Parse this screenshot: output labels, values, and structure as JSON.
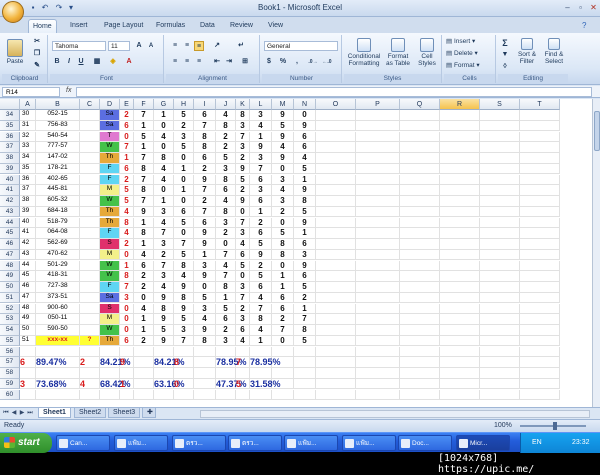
{
  "window": {
    "title": "Book1 - Microsoft Excel"
  },
  "ribbon_tabs": [
    "Home",
    "Insert",
    "Page Layout",
    "Formulas",
    "Data",
    "Review",
    "View"
  ],
  "ribbon": {
    "clipboard": {
      "paste": "Paste",
      "label": "Clipboard"
    },
    "font": {
      "name": "Tahoma",
      "size": "11",
      "bold": "B",
      "italic": "I",
      "underline": "U",
      "grow": "A",
      "shrink": "A",
      "label": "Font"
    },
    "alignment": {
      "label": "Alignment"
    },
    "number": {
      "format": "General",
      "currency": "$",
      "percent": "%",
      "comma": ",",
      "label": "Number"
    },
    "styles": {
      "conditional": "Conditional Formatting",
      "table": "Format as Table",
      "cell": "Cell Styles",
      "label": "Styles"
    },
    "cells": {
      "insert": "Insert",
      "delete": "Delete",
      "format": "Format",
      "label": "Cells"
    },
    "editing": {
      "sort": "Sort & Filter",
      "find": "Find & Select",
      "sigma": "Σ",
      "label": "Editing"
    }
  },
  "formula_bar": {
    "name_box": "R14",
    "fx": "fx",
    "value": ""
  },
  "columns": [
    "A",
    "B",
    "C",
    "D",
    "E",
    "F",
    "G",
    "H",
    "I",
    "J",
    "K",
    "L",
    "M",
    "N",
    "O",
    "P",
    "Q",
    "R",
    "S",
    "T"
  ],
  "selected_column": "R",
  "day_colors": {
    "Sa": "#5b6ee1",
    "S": "#e0306c",
    "T": "#e07ad0",
    "W": "#44c24a",
    "Th": "#e6a93a",
    "F": "#5fd5f3",
    "M": "#f3f08a"
  },
  "rows": [
    {
      "r": "34",
      "a": "30",
      "b": "052-15",
      "d": "Sa",
      "n": [
        "2",
        "7",
        "1",
        "5",
        "6",
        "4",
        "8",
        "3",
        "9",
        "0"
      ]
    },
    {
      "r": "35",
      "a": "31",
      "b": "756-83",
      "d": "Sa",
      "n": [
        "6",
        "1",
        "0",
        "2",
        "7",
        "8",
        "3",
        "4",
        "5",
        "9"
      ]
    },
    {
      "r": "36",
      "a": "32",
      "b": "540-54",
      "d": "T",
      "n": [
        "0",
        "5",
        "4",
        "3",
        "8",
        "2",
        "7",
        "1",
        "9",
        "6"
      ]
    },
    {
      "r": "37",
      "a": "33",
      "b": "777-57",
      "d": "W",
      "n": [
        "7",
        "1",
        "0",
        "5",
        "8",
        "2",
        "3",
        "9",
        "4",
        "6"
      ]
    },
    {
      "r": "38",
      "a": "34",
      "b": "147-02",
      "d": "Th",
      "n": [
        "1",
        "7",
        "8",
        "0",
        "6",
        "5",
        "2",
        "3",
        "9",
        "4"
      ]
    },
    {
      "r": "39",
      "a": "35",
      "b": "178-21",
      "d": "F",
      "n": [
        "6",
        "8",
        "4",
        "1",
        "2",
        "3",
        "9",
        "7",
        "0",
        "5"
      ]
    },
    {
      "r": "40",
      "a": "36",
      "b": "402-65",
      "d": "F",
      "n": [
        "2",
        "7",
        "4",
        "0",
        "9",
        "8",
        "5",
        "6",
        "3",
        "1"
      ]
    },
    {
      "r": "41",
      "a": "37",
      "b": "445-81",
      "d": "M",
      "n": [
        "5",
        "8",
        "0",
        "1",
        "7",
        "6",
        "2",
        "3",
        "4",
        "9"
      ]
    },
    {
      "r": "42",
      "a": "38",
      "b": "605-32",
      "d": "W",
      "n": [
        "5",
        "7",
        "1",
        "0",
        "2",
        "4",
        "9",
        "6",
        "3",
        "8"
      ]
    },
    {
      "r": "43",
      "a": "39",
      "b": "684-18",
      "d": "Th",
      "n": [
        "4",
        "9",
        "3",
        "6",
        "7",
        "8",
        "0",
        "1",
        "2",
        "5"
      ]
    },
    {
      "r": "44",
      "a": "40",
      "b": "518-79",
      "d": "Th",
      "n": [
        "8",
        "1",
        "4",
        "5",
        "6",
        "3",
        "7",
        "2",
        "0",
        "9"
      ]
    },
    {
      "r": "45",
      "a": "41",
      "b": "064-08",
      "d": "F",
      "n": [
        "4",
        "8",
        "7",
        "0",
        "9",
        "2",
        "3",
        "6",
        "5",
        "1"
      ]
    },
    {
      "r": "46",
      "a": "42",
      "b": "562-69",
      "d": "S",
      "n": [
        "2",
        "1",
        "3",
        "7",
        "9",
        "0",
        "4",
        "5",
        "8",
        "6"
      ]
    },
    {
      "r": "47",
      "a": "43",
      "b": "470-62",
      "d": "M",
      "n": [
        "0",
        "4",
        "2",
        "5",
        "1",
        "7",
        "6",
        "9",
        "8",
        "3"
      ]
    },
    {
      "r": "48",
      "a": "44",
      "b": "501-29",
      "d": "W",
      "n": [
        "1",
        "6",
        "7",
        "8",
        "3",
        "4",
        "5",
        "2",
        "0",
        "9"
      ]
    },
    {
      "r": "49",
      "a": "45",
      "b": "418-31",
      "d": "W",
      "n": [
        "8",
        "2",
        "3",
        "4",
        "9",
        "7",
        "0",
        "5",
        "1",
        "6"
      ]
    },
    {
      "r": "50",
      "a": "46",
      "b": "727-38",
      "d": "F",
      "n": [
        "7",
        "2",
        "4",
        "9",
        "0",
        "8",
        "3",
        "6",
        "1",
        "5"
      ]
    },
    {
      "r": "51",
      "a": "47",
      "b": "373-51",
      "d": "Sa",
      "n": [
        "3",
        "0",
        "9",
        "8",
        "5",
        "1",
        "7",
        "4",
        "6",
        "2"
      ]
    },
    {
      "r": "52",
      "a": "48",
      "b": "900-60",
      "d": "S",
      "n": [
        "0",
        "4",
        "8",
        "9",
        "3",
        "5",
        "2",
        "7",
        "6",
        "1"
      ]
    },
    {
      "r": "53",
      "a": "49",
      "b": "050-11",
      "d": "M",
      "n": [
        "0",
        "1",
        "9",
        "5",
        "4",
        "6",
        "3",
        "8",
        "2",
        "7"
      ]
    },
    {
      "r": "54",
      "a": "50",
      "b": "590-50",
      "d": "W",
      "n": [
        "0",
        "1",
        "5",
        "3",
        "9",
        "2",
        "6",
        "4",
        "7",
        "8"
      ]
    },
    {
      "r": "55",
      "a": "51",
      "b": "xxx-xx",
      "c": "?",
      "d": "Th",
      "n": [
        "6",
        "2",
        "9",
        "7",
        "8",
        "3",
        "4",
        "1",
        "0",
        "5"
      ]
    }
  ],
  "stat_rows": [
    {
      "r": "57",
      "cells": [
        {
          "col": "A",
          "text": "6"
        },
        {
          "col": "B",
          "text": "89.47%"
        },
        {
          "col": "C",
          "text": "2"
        },
        {
          "col": "D",
          "text": "84.21%"
        },
        {
          "col": "E",
          "text": "9"
        },
        {
          "col": "G",
          "text": "84.21%"
        },
        {
          "col": "H",
          "text": "8"
        },
        {
          "col": "J",
          "text": "78.95%"
        },
        {
          "col": "K",
          "text": "7"
        },
        {
          "col": "L",
          "text": "78.95%"
        }
      ]
    },
    {
      "r": "59",
      "cells": [
        {
          "col": "A",
          "text": "3"
        },
        {
          "col": "B",
          "text": "73.68%"
        },
        {
          "col": "C",
          "text": "4"
        },
        {
          "col": "D",
          "text": "68.42%"
        },
        {
          "col": "E",
          "text": "1"
        },
        {
          "col": "G",
          "text": "63.16%"
        },
        {
          "col": "H",
          "text": "0"
        },
        {
          "col": "J",
          "text": "47.37%"
        },
        {
          "col": "K",
          "text": "5"
        },
        {
          "col": "L",
          "text": "31.58%"
        }
      ]
    }
  ],
  "empty_rows": [
    "56",
    "58",
    "60"
  ],
  "sheets": [
    "Sheet1",
    "Sheet2",
    "Sheet3"
  ],
  "status": {
    "ready": "Ready",
    "zoom": "100%"
  },
  "taskbar": {
    "start": "start",
    "tasks": [
      "Can...",
      "แฟ้ม...",
      "ตรว...",
      "ตรว...",
      "แฟ้ม...",
      "แฟ้ม...",
      "Doc...",
      "Micr..."
    ],
    "lang": "EN",
    "clock": "23:32"
  },
  "watermark": "[1024x768] https://upic.me/"
}
